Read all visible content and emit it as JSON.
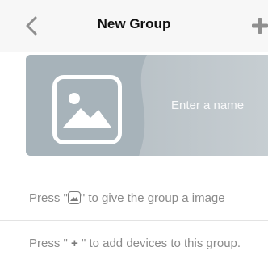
{
  "nav": {
    "title": "New Group",
    "back_icon": "chevron-left-icon",
    "add_icon": "plus-icon"
  },
  "banner": {
    "image_icon": "image-icon",
    "name_placeholder": "Enter a name"
  },
  "hints": {
    "image_prefix": "Press \"",
    "image_suffix": "\" to give the group a image",
    "add_prefix": "Press \" ",
    "add_glyph": "+",
    "add_suffix": " \" to add devices to this group."
  },
  "colors": {
    "banner": "#b7c1c7",
    "accent": "#8a8a8a"
  }
}
